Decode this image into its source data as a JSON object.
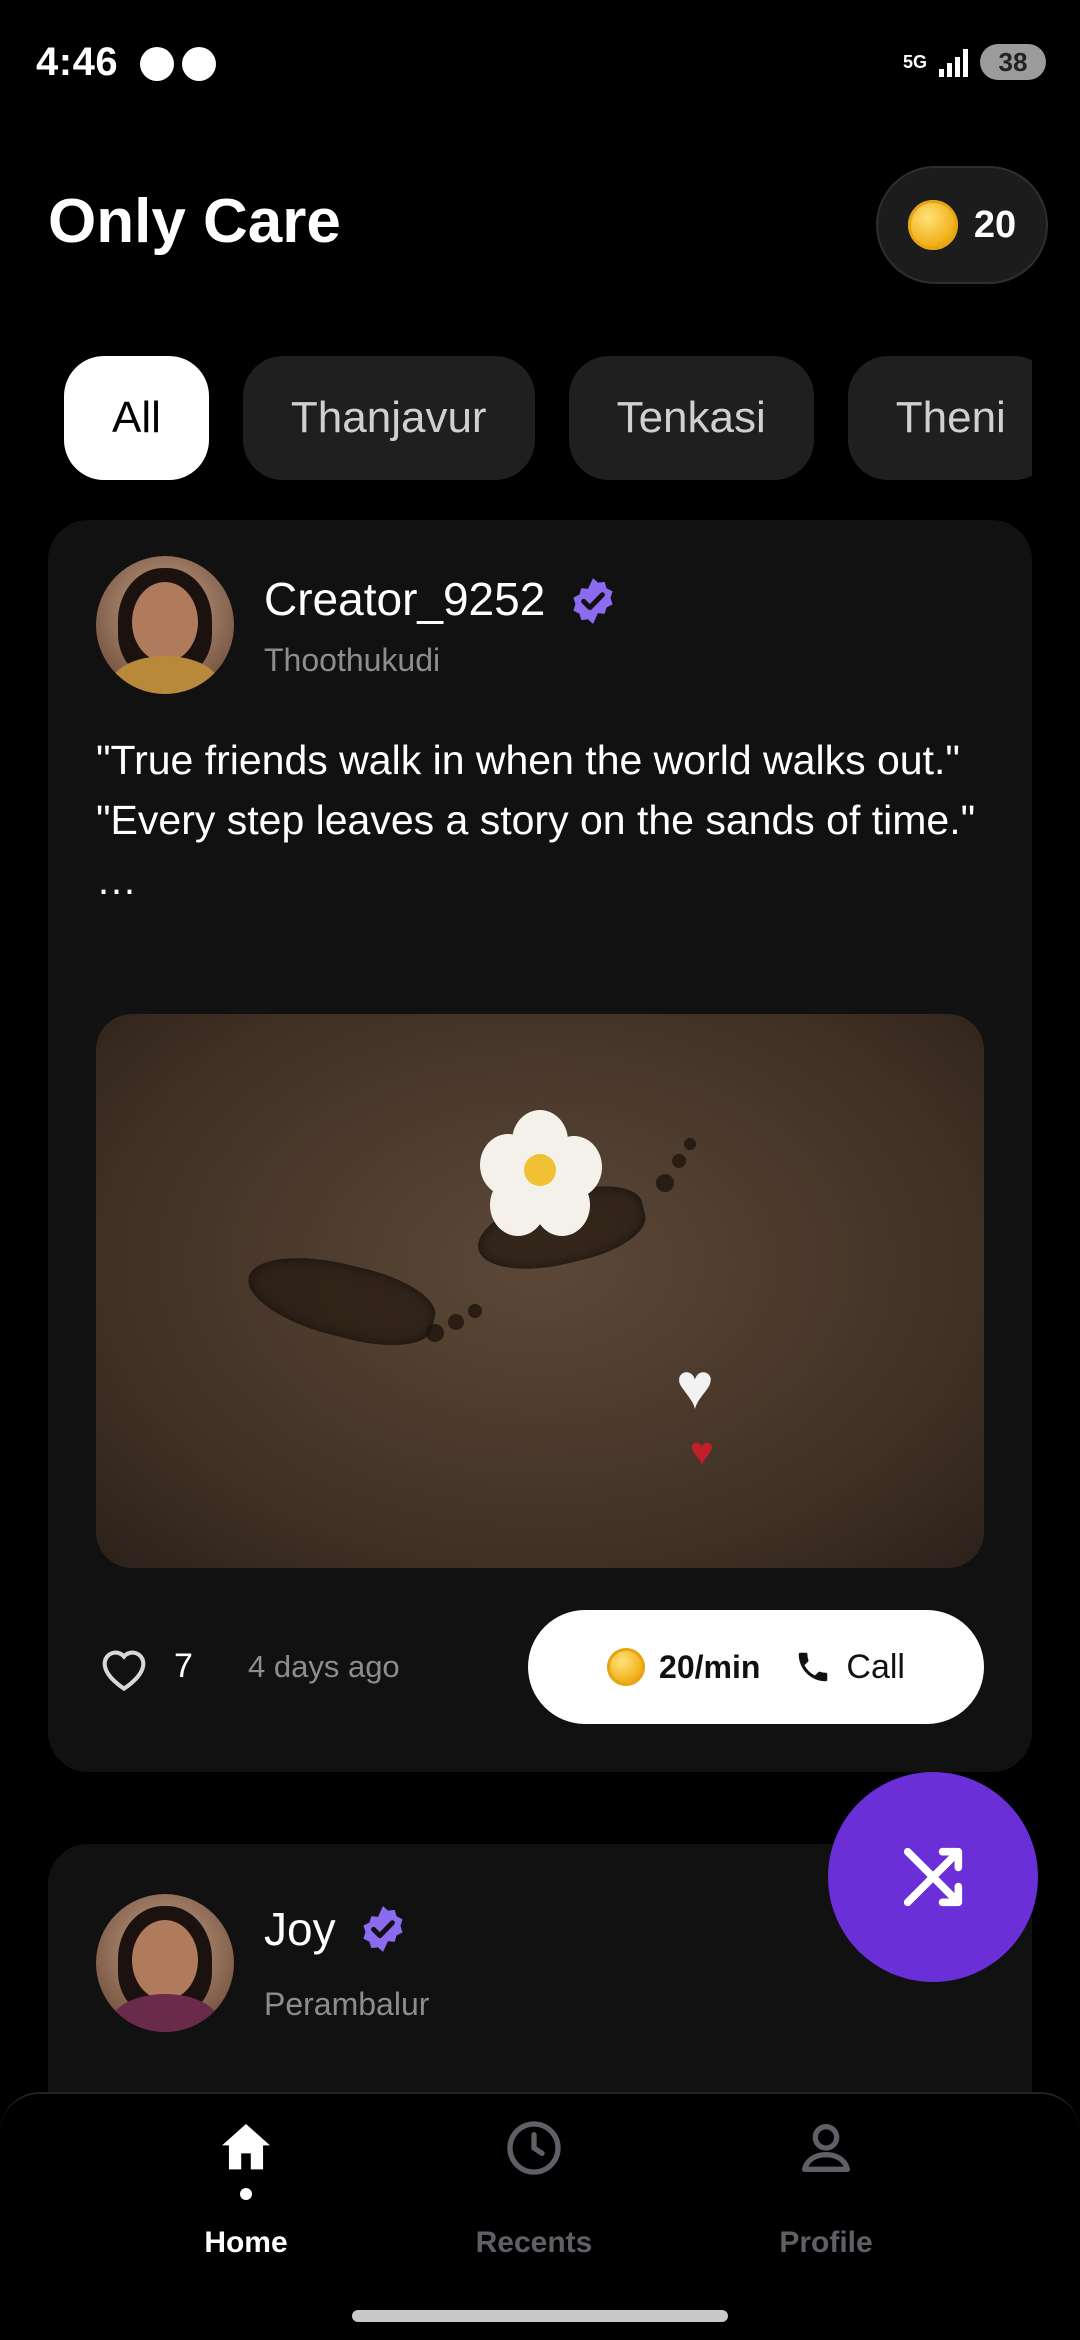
{
  "status_bar": {
    "time": "4:46",
    "network": "5G",
    "battery": "38"
  },
  "header": {
    "title": "Only Care",
    "coin_balance": "20"
  },
  "filters": {
    "chips": [
      "All",
      "Thanjavur",
      "Tenkasi",
      "Theni"
    ],
    "active": "All"
  },
  "posts": [
    {
      "creator_name": "Creator_9252",
      "verified": true,
      "location": "Thoothukudi",
      "text": "\"True friends walk in when the world walks out.\"\n\"Every step leaves a story on the sands of time.\" …",
      "likes": "7",
      "time_ago": "4 days ago",
      "rate": "20/min",
      "call_label": "Call"
    },
    {
      "creator_name": "Joy",
      "verified": true,
      "location": "Perambalur"
    }
  ],
  "fab": {
    "icon": "shuffle-icon"
  },
  "bottom_nav": {
    "items": [
      {
        "label": "Home",
        "icon": "home-icon",
        "active": true
      },
      {
        "label": "Recents",
        "icon": "clock-icon",
        "active": false
      },
      {
        "label": "Profile",
        "icon": "person-icon",
        "active": false
      }
    ]
  },
  "colors": {
    "accent": "#6a2fd6",
    "verified": "#8b6cf0",
    "background": "#000000",
    "card": "#111111"
  }
}
